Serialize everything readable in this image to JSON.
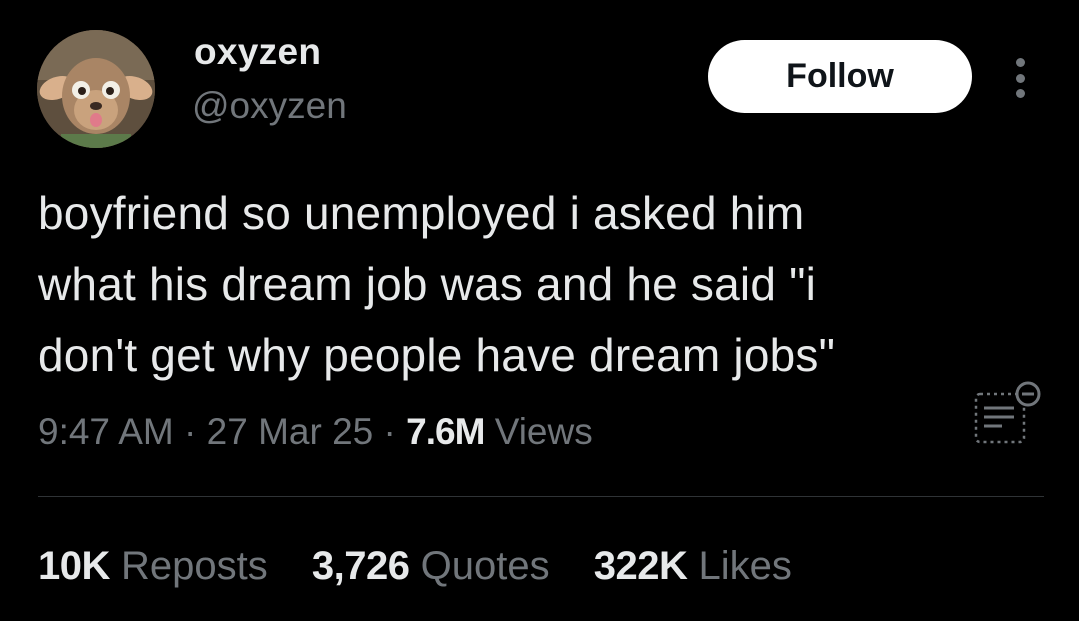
{
  "author": {
    "display_name": "oxyzen",
    "handle": "@oxyzen",
    "avatar_icon": "cartoon-deer-avatar"
  },
  "actions": {
    "follow_label": "Follow",
    "more_icon": "more-vertical-icon",
    "community_notes_icon": "community-notes-icon"
  },
  "tweet": {
    "text": "boyfriend so unemployed i asked him\nwhat his dream job was and he said \"i\ndon't get why people have dream jobs\"",
    "time": "9:47 AM",
    "separator": "·",
    "date": "27 Mar 25",
    "views_count": "7.6M",
    "views_label": "Views"
  },
  "stats": {
    "reposts_count": "10K",
    "reposts_label": "Reposts",
    "quotes_count": "3,726",
    "quotes_label": "Quotes",
    "likes_count": "322K",
    "likes_label": "Likes"
  },
  "colors": {
    "background": "#000000",
    "primary_text": "#e7e9ea",
    "secondary_text": "#71767b",
    "divider": "#2f3336",
    "follow_bg": "#ffffff",
    "follow_text": "#0f1419"
  }
}
